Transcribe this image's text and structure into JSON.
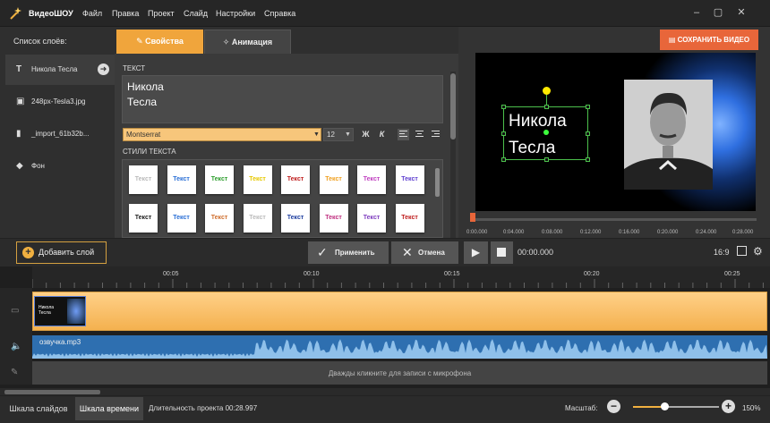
{
  "titlebar": {
    "app_name": "ВидеоШОУ",
    "menu": [
      "Файл",
      "Правка",
      "Проект",
      "Слайд",
      "Настройки",
      "Справка"
    ]
  },
  "layers": {
    "title": "Список слоёв:",
    "items": [
      {
        "label": "Никола Тесла",
        "icon": "text-icon"
      },
      {
        "label": "248px-Tesla3.jpg",
        "icon": "image-icon"
      },
      {
        "label": "_import_61b32b...",
        "icon": "video-icon"
      },
      {
        "label": "Фон",
        "icon": "fill-icon"
      }
    ]
  },
  "tabs": {
    "properties": "Свойства",
    "animation": "Анимация"
  },
  "props": {
    "text_label": "ТЕКСТ",
    "text_value": "Никола\nТесла",
    "font": "Montserrat",
    "size": "12",
    "bold": "Ж",
    "italic": "К",
    "styles_label": "СТИЛИ ТЕКСТА",
    "style_text": "Текст",
    "style_colors": [
      "#bbbbbb",
      "#2a6fd6",
      "#2f9e2f",
      "#e6c800",
      "#c02020",
      "#f0a020",
      "#c040c0",
      "#6040d0",
      "#222222",
      "#2a6fd6",
      "#d07030",
      "#bbbbbb",
      "#2040a0",
      "#c03080",
      "#8040c0",
      "#c02020"
    ]
  },
  "preview": {
    "save_button": "СОХРАНИТЬ ВИДЕО",
    "overlay_text": "Никола\nТесла",
    "ticks": [
      "0:00.000",
      "0:04.000",
      "0:08.000",
      "0:12.000",
      "0:16.000",
      "0:20.000",
      "0:24.000",
      "0:28.000"
    ]
  },
  "controls": {
    "add_layer": "Добавить слой",
    "apply": "Применить",
    "cancel": "Отмена",
    "timecode": "00:00.000",
    "ratio": "16:9"
  },
  "timeline": {
    "marks": [
      "00:05",
      "00:10",
      "00:15",
      "00:20",
      "00:25"
    ],
    "thumb_text": "Никола\nТесла",
    "audio_file": "озвучка.mp3",
    "mic_hint": "Дважды кликните для записи с микрофона"
  },
  "footer": {
    "slides_view": "Шкала слайдов",
    "timeline_view": "Шкала времени",
    "duration": "Длительность проекта 00:28.997",
    "scale_label": "Масштаб:",
    "zoom": "150%"
  },
  "colors": {
    "accent": "#f0a53c",
    "save": "#e8663a",
    "audio": "#2e6fb0"
  }
}
